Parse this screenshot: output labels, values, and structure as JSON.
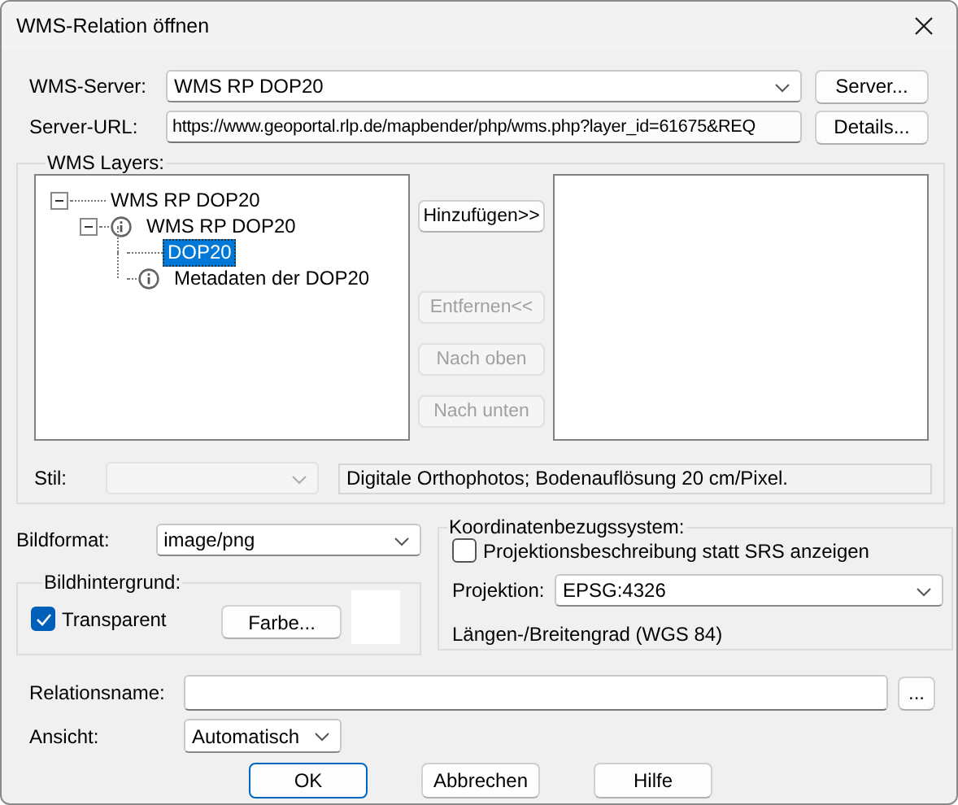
{
  "window": {
    "title": "WMS-Relation öffnen"
  },
  "server": {
    "label": "WMS-Server:",
    "value": "WMS RP DOP20",
    "button": "Server..."
  },
  "url": {
    "label": "Server-URL:",
    "value": "https://www.geoportal.rlp.de/mapbender/php/wms.php?layer_id=61675&REQ",
    "button": "Details..."
  },
  "layers": {
    "legend": "WMS Layers:",
    "tree": [
      {
        "label": "WMS RP DOP20",
        "kind": "plain",
        "selected": false,
        "expanded": true,
        "children": [
          {
            "label": "WMS RP DOP20",
            "kind": "info",
            "selected": false,
            "expanded": true,
            "children": [
              {
                "label": "DOP20",
                "kind": "plain",
                "selected": true
              },
              {
                "label": "Metadaten der DOP20",
                "kind": "info",
                "selected": false
              }
            ]
          }
        ]
      }
    ],
    "buttons": [
      {
        "label": "Hinzufügen>>",
        "disabled": false
      },
      {
        "label": "Entfernen<<",
        "disabled": true
      },
      {
        "label": "Nach oben",
        "disabled": true
      },
      {
        "label": "Nach unten",
        "disabled": true
      }
    ],
    "style": {
      "label": "Stil:",
      "disabled": true
    },
    "description": "Digitale Orthophotos; Bodenauflösung 20 cm/Pixel."
  },
  "image_format": {
    "label": "Bildformat:",
    "value": "image/png"
  },
  "background": {
    "legend": "Bildhintergrund:",
    "transparent": {
      "label": "Transparent",
      "checked": true
    },
    "color_button": "Farbe..."
  },
  "crs": {
    "legend": "Koordinatenbezugssystem:",
    "describe": {
      "label": "Projektionsbeschreibung statt SRS anzeigen",
      "checked": false
    },
    "projection_label": "Projektion:",
    "projection": "EPSG:4326",
    "description": "Längen-/Breitengrad (WGS 84)"
  },
  "relation": {
    "label": "Relationsname:",
    "button": "..."
  },
  "view": {
    "label": "Ansicht:",
    "value": "Automatisch"
  },
  "actions": [
    {
      "label": "OK",
      "default": true
    },
    {
      "label": "Abbrechen",
      "default": false
    },
    {
      "label": "Hilfe",
      "default": false
    }
  ]
}
